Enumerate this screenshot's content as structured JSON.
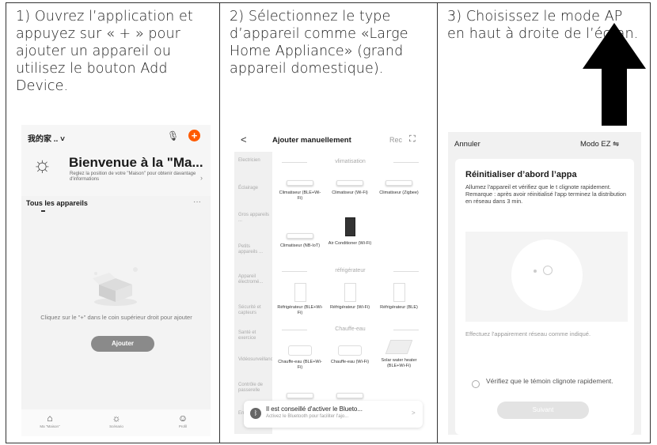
{
  "steps": [
    "1) Ouvrez l’application et appuyez sur « + » pour ajouter un appareil ou utilisez le bouton Add Device.",
    "2) Sélectionnez le type d’appareil comme «Large Home Appliance» (grand appareil domestique).",
    "3) Choisissez le mode AP en haut à droite de l’écran."
  ],
  "phone1": {
    "home": "我的家 .. ˅",
    "welcome": "Bienvenue à la \"Ma...",
    "welcome_sub": "Reglez la position de votre \"Maison\" pour obtenir davantage d'informations",
    "all_devices": "Tous les appareils",
    "more": "···",
    "empty_text": "Cliquez sur le \"+\" dans le coin supérieur droit pour ajouter",
    "add_button": "Ajouter",
    "tabs": [
      "Ma \"Maison\"",
      "Scénario",
      "Profil"
    ]
  },
  "phone2": {
    "back": "<",
    "title": "Ajouter manuellement",
    "rec": "Rec",
    "categories": [
      "Electricien",
      "Éclairage",
      "Gros appareils ...",
      "Petits appareils ...",
      "Appareil électromé...",
      "Sécurité et capteurs",
      "Santé et exercice",
      "Vidéosurveillance",
      "Contrôle de passerelle",
      "Energy"
    ],
    "section_clim": "vlimatisation",
    "section_fridge": "réfrigérateur",
    "section_heater": "Chauffe-eau",
    "clim_devices": [
      "Climatiseur (BLE+Wi-Fi)",
      "Climatiseur (Wi-Fi)",
      "Climatiseur (Zigbee)",
      "Climatiseur (NB-IoT)",
      "Air Conditioner (Wi-Fi)"
    ],
    "fridge_devices": [
      "Réfrigérateur (BLE+Wi-Fi)",
      "Réfrigérateur (Wi-Fi)",
      "Réfrigérateur (BLE)"
    ],
    "heater_devices": [
      "Chauffe-eau (BLE+Wi-Fi)",
      "Chauffe-eau (Wi-Fi)",
      "Solar water heater (BLE+Wi-Fi)"
    ],
    "bt_title": "Il est conseillé d'activer le Blueto...",
    "bt_sub": "Activez le Bluetooth pour faciliter l'ajo...",
    "bt_chevron": ">"
  },
  "phone3": {
    "cancel": "Annuler",
    "mode": "Modo EZ ⇋",
    "title": "Réinitialiser d’abord l’appa",
    "body": "Allumez l'appareil et vérifiez que le t clignote rapidement. Remarque : après avoir réinitialisé l'app terminez la distribution en réseau dans 3 min.",
    "instruction": "Effectuez l'appairement réseau comme indiqué.",
    "checkbox_label": "Vérifiez que le témoin clignote rapidement.",
    "next_button": "Suivant"
  }
}
